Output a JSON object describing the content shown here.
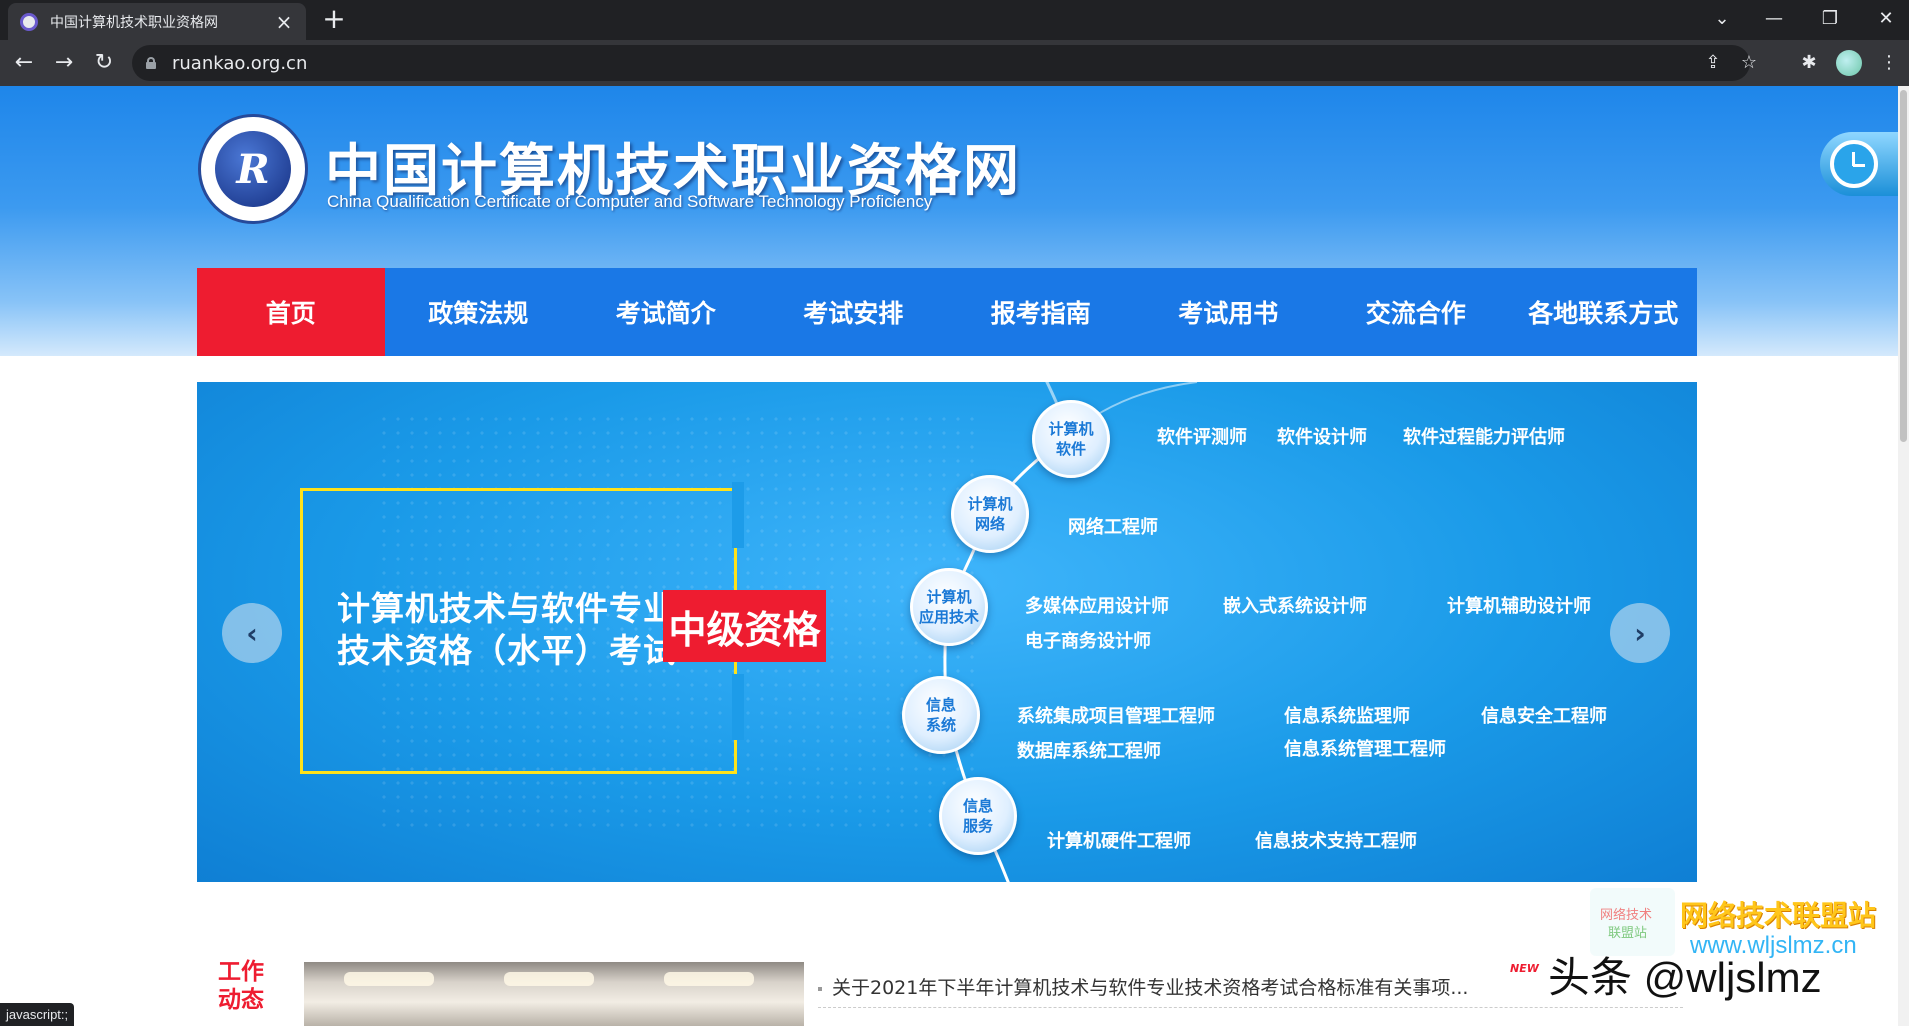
{
  "browser": {
    "tab_title": "中国计算机技术职业资格网",
    "tab_close": "×",
    "new_tab": "+",
    "url": "ruankao.org.cn",
    "status_text": "javascript:;"
  },
  "icons": {
    "back": "←",
    "forward": "→",
    "reload": "↻",
    "share": "⇪",
    "star": "☆",
    "extensions": "✱",
    "menu": "⋮",
    "tab_search": "⌄",
    "minimize": "—",
    "restore": "❐",
    "close": "✕"
  },
  "header": {
    "title": "中国计算机技术职业资格网",
    "subtitle": "China Qualification Certificate of Computer and Software Technology Proficiency",
    "logo_letter": "R"
  },
  "nav": {
    "items": [
      {
        "label": "首页",
        "active": true
      },
      {
        "label": "政策法规"
      },
      {
        "label": "考试简介"
      },
      {
        "label": "考试安排"
      },
      {
        "label": "报考指南"
      },
      {
        "label": "考试用书"
      },
      {
        "label": "交流合作"
      },
      {
        "label": "各地联系方式"
      }
    ]
  },
  "banner": {
    "line1": "计算机技术与软件专业",
    "line2": "技术资格（水平）考试",
    "badge": "中级资格",
    "prev": "‹",
    "next": "›",
    "categories": [
      {
        "node": [
          "计算机",
          "软件"
        ],
        "certs": [
          "软件评测师",
          "软件设计师",
          "软件过程能力评估师"
        ]
      },
      {
        "node": [
          "计算机",
          "网络"
        ],
        "certs": [
          "网络工程师"
        ]
      },
      {
        "node": [
          "计算机",
          "应用技术"
        ],
        "certs": [
          "多媒体应用设计师",
          "嵌入式系统设计师",
          "计算机辅助设计师",
          "电子商务设计师"
        ]
      },
      {
        "node": [
          "信息",
          "系统"
        ],
        "certs": [
          "系统集成项目管理工程师",
          "信息系统监理师",
          "信息安全工程师",
          "数据库系统工程师",
          "信息系统管理工程师"
        ]
      },
      {
        "node": [
          "信息",
          "服务"
        ],
        "certs": [
          "计算机硬件工程师",
          "信息技术支持工程师"
        ]
      }
    ]
  },
  "news": {
    "label": [
      "工作",
      "动态"
    ],
    "items": [
      "关于2021年下半年计算机技术与软件专业技术资格考试合格标准有关事项..."
    ],
    "new_badge": "NEW"
  },
  "watermark": {
    "box": [
      "网络技术",
      "联盟站"
    ],
    "title": "网络技术联盟站",
    "url": "www.wljslmz.cn",
    "handle": "头条 @wljslmz"
  }
}
